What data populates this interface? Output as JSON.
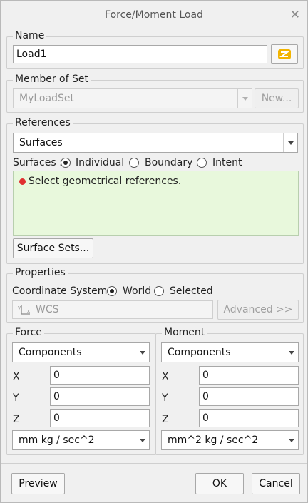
{
  "title": "Force/Moment Load",
  "name_section": {
    "legend": "Name",
    "value": "Load1"
  },
  "member_of_set": {
    "legend": "Member of Set",
    "value": "MyLoadSet",
    "new_label": "New..."
  },
  "references": {
    "legend": "References",
    "type_value": "Surfaces",
    "surfaces_label": "Surfaces :",
    "options": [
      "Individual",
      "Boundary",
      "Intent"
    ],
    "selected_option": "Individual",
    "message": "Select geometrical references.",
    "surface_sets_label": "Surface Sets..."
  },
  "properties": {
    "legend": "Properties",
    "coord_label": "Coordinate System:",
    "coord_options": [
      "World",
      "Selected"
    ],
    "coord_selected": "World",
    "wcs_value": "WCS",
    "advanced_label": "Advanced >>"
  },
  "force": {
    "legend": "Force",
    "type_value": "Components",
    "x_label": "X",
    "x_value": "0",
    "y_label": "Y",
    "y_value": "0",
    "z_label": "Z",
    "z_value": "0",
    "units": "mm kg / sec^2"
  },
  "moment": {
    "legend": "Moment",
    "type_value": "Components",
    "x_label": "X",
    "x_value": "0",
    "y_label": "Y",
    "y_value": "0",
    "z_label": "Z",
    "z_value": "0",
    "units": "mm^2 kg / sec^2"
  },
  "footer": {
    "preview_label": "Preview",
    "ok_label": "OK",
    "cancel_label": "Cancel"
  },
  "colors": {
    "message_bg": "#e8f8dc",
    "error_dot": "#e03030",
    "select_icon": "#f2b400"
  }
}
